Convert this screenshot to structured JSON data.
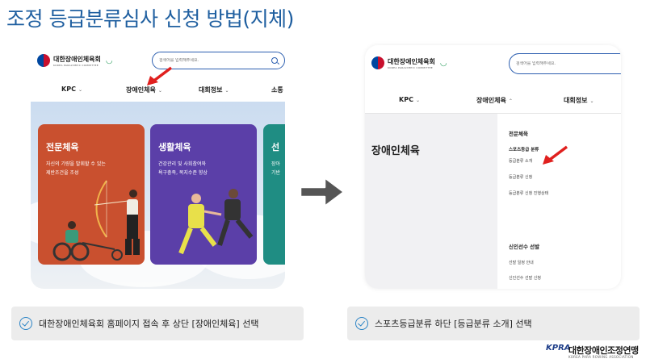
{
  "slide_title": "조정 등급분류심사 신청 방법(지체)",
  "left_screen": {
    "logo_name": "대한장애인체육회",
    "logo_sub": "KOREA PARALYMPIC COMMITTEE",
    "search_placeholder": "검색어를 입력해주세요.",
    "nav": [
      "KPC",
      "장애인체육",
      "대회정보",
      "소통"
    ],
    "cards": [
      {
        "title": "전문체육",
        "desc": [
          "자신의 기량을 발휘할 수 있는",
          "제반조건을 조성"
        ],
        "color": "#c9502f"
      },
      {
        "title": "생활체육",
        "desc": [
          "건강관리 및 사회참여와",
          "욕구충족, 복지수준 향상"
        ],
        "color": "#5b3fa8"
      },
      {
        "title": "선",
        "desc": [
          "장아",
          "기반"
        ],
        "color": "#1f8d83"
      }
    ]
  },
  "right_screen": {
    "logo_name": "대한장애인체육회",
    "logo_sub": "KOREA PARALYMPIC COMMITTEE",
    "search_placeholder": "검색어를 입력해주세요.",
    "nav": [
      "KPC",
      "장애인체육",
      "대회정보"
    ],
    "heading": "장애인체육",
    "menu_group1_title": "전문체육",
    "menu_group1_items": [
      "스포츠등급 분류",
      "등급분류 소개",
      "등급분류 신청",
      "등급분류 신청 진행상태"
    ],
    "menu_group2_title": "신인선수 선발",
    "menu_group2_items": [
      "선발 일정 안내",
      "신인선수 선발 신청"
    ]
  },
  "captions": [
    "대한장애인체육회 홈페이지 접속 후 상단 [장애인체육] 선택",
    "스포츠등급분류 하단 [등급분류 소개] 선택"
  ],
  "footer": {
    "mark": "KPRA",
    "name": "대한장애인조정연맹",
    "sub": "KOREA PARA ROWING ASSOCIATION"
  },
  "colors": {
    "title": "#1f5fa0",
    "accent_red": "#e0201e",
    "check": "#2b84c6"
  }
}
